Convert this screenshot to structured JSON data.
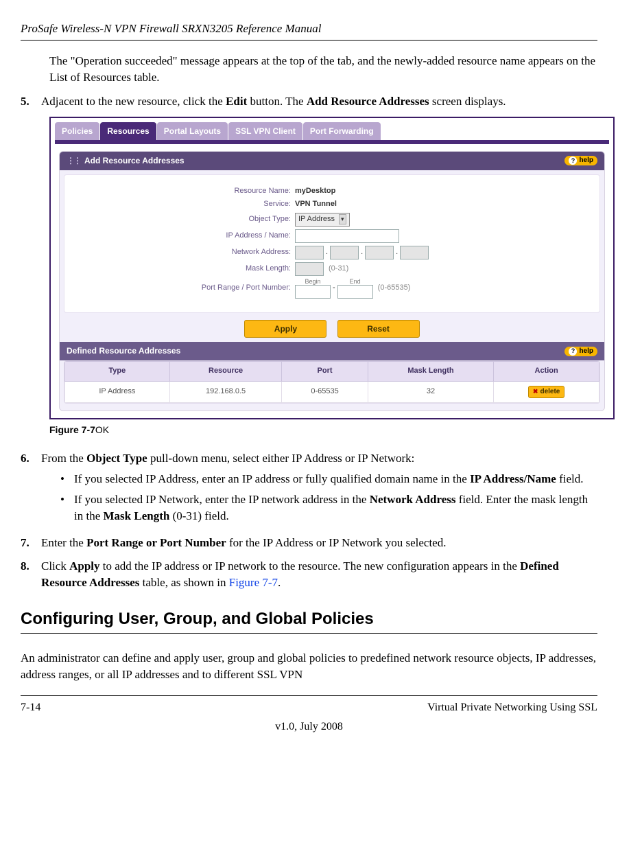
{
  "header": {
    "title": "ProSafe Wireless-N VPN Firewall SRXN3205 Reference Manual"
  },
  "para1": "The \"Operation succeeded\" message appears at the top of the tab, and the newly-added resource name appears on the List of Resources table.",
  "step5": {
    "num": "5.",
    "text_a": "Adjacent to the new resource, click the ",
    "bold_a": "Edit",
    "text_b": " button. The ",
    "bold_b": "Add Resource Addresses",
    "text_c": " screen displays."
  },
  "figure": {
    "label_bold": "Figure 7-7",
    "label_tail": "OK"
  },
  "shot": {
    "tabs": [
      "Policies",
      "Resources",
      "Portal Layouts",
      "SSL VPN Client",
      "Port Forwarding"
    ],
    "active_tab_index": 1,
    "panel_title": "Add Resource Addresses",
    "help": "help",
    "fields": {
      "resource_name_label": "Resource Name:",
      "resource_name_value": "myDesktop",
      "service_label": "Service:",
      "service_value": "VPN Tunnel",
      "object_type_label": "Object Type:",
      "object_type_value": "IP Address",
      "ip_name_label": "IP Address / Name:",
      "net_addr_label": "Network Address:",
      "mask_label": "Mask Length:",
      "mask_hint": "(0-31)",
      "port_label": "Port Range / Port Number:",
      "begin": "Begin",
      "end": "End",
      "port_hint": "(0-65535)"
    },
    "buttons": {
      "apply": "Apply",
      "reset": "Reset"
    },
    "subpanel_title": "Defined Resource Addresses",
    "table": {
      "headers": [
        "Type",
        "Resource",
        "Port",
        "Mask Length",
        "Action"
      ],
      "row": {
        "type": "IP Address",
        "resource": "192.168.0.5",
        "port": "0-65535",
        "mask": "32",
        "delete": "delete"
      }
    }
  },
  "step6": {
    "num": "6.",
    "text_a": "From the ",
    "bold_a": "Object Type",
    "text_b": " pull-down menu, select either IP Address or IP Network:",
    "bullet1_a": "If you selected IP Address, enter an IP address or fully qualified domain name in the ",
    "bullet1_bold": "IP Address/Name",
    "bullet1_b": " field.",
    "bullet2_a": "If you selected IP Network, enter the IP network address in the ",
    "bullet2_bold1": "Network Address",
    "bullet2_b": " field. Enter the mask length in the ",
    "bullet2_bold2": "Mask Length",
    "bullet2_c": " (0-31) field."
  },
  "step7": {
    "num": "7.",
    "text_a": "Enter the ",
    "bold_a": "Port Range or Port Number",
    "text_b": " for the IP Address or IP Network you selected."
  },
  "step8": {
    "num": "8.",
    "text_a": "Click ",
    "bold_a": "Apply",
    "text_b": " to add the IP address or IP network to the resource. The new configuration appears in the ",
    "bold_b": "Defined Resource Addresses",
    "text_c": " table, as shown in ",
    "xref": "Figure 7-7",
    "text_d": "."
  },
  "h2": "Configuring User, Group, and Global Policies",
  "closing_para": "An administrator can define and apply user, group and global policies to predefined network resource objects, IP addresses, address ranges, or all IP addresses and to different SSL VPN",
  "footer": {
    "left": "7-14",
    "right": "Virtual Private Networking Using SSL",
    "center": "v1.0, July 2008"
  }
}
